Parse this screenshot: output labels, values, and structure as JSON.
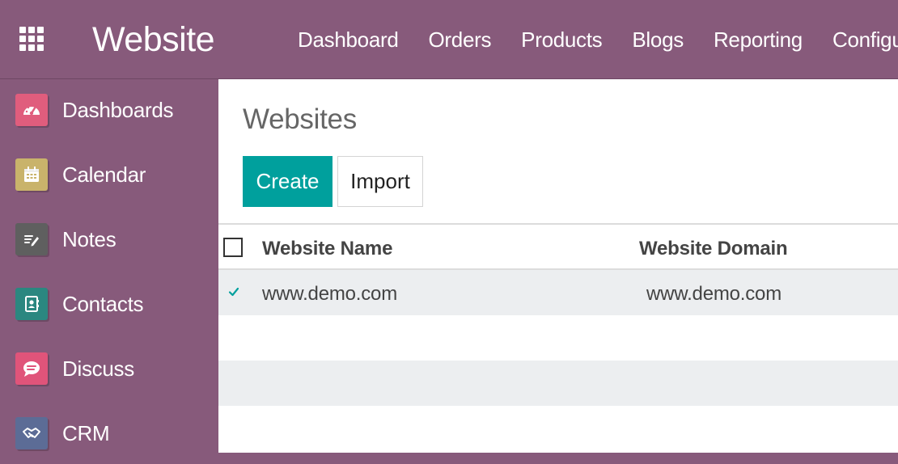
{
  "app": {
    "title": "Website",
    "colors": {
      "brand": "#875a7b",
      "accent": "#00a09d"
    }
  },
  "top_menu": [
    {
      "label": "Dashboard"
    },
    {
      "label": "Orders"
    },
    {
      "label": "Products"
    },
    {
      "label": "Blogs"
    },
    {
      "label": "Reporting"
    },
    {
      "label": "Configura"
    }
  ],
  "sidebar": {
    "items": [
      {
        "label": "Dashboards",
        "icon": "dashboard-gauge-icon",
        "color": "#e05d7d"
      },
      {
        "label": "Calendar",
        "icon": "calendar-icon",
        "color": "#c9b36b"
      },
      {
        "label": "Notes",
        "icon": "notes-pencil-icon",
        "color": "#5f5f5f"
      },
      {
        "label": "Contacts",
        "icon": "contact-card-icon",
        "color": "#2b8780"
      },
      {
        "label": "Discuss",
        "icon": "chat-bubble-icon",
        "color": "#e0547a"
      },
      {
        "label": "CRM",
        "icon": "handshake-icon",
        "color": "#5c6c96"
      }
    ]
  },
  "main": {
    "page_title": "Websites",
    "create_label": "Create",
    "import_label": "Import",
    "table": {
      "columns": [
        "Website Name",
        "Website Domain"
      ],
      "rows": [
        {
          "name": "www.demo.com",
          "domain": "www.demo.com",
          "selected": true
        }
      ]
    }
  }
}
